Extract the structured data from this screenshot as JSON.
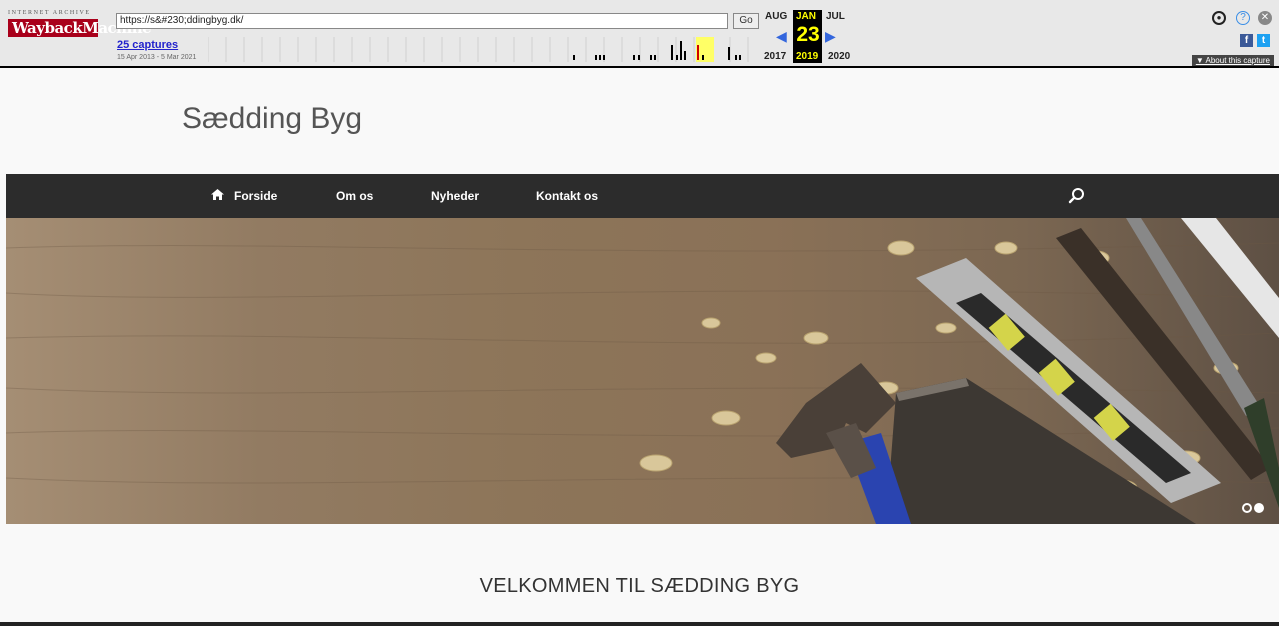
{
  "wayback": {
    "logo_top": "INTERNET ARCHIVE",
    "logo_main": "WaybackMachine",
    "url": "https://s&#230;ddingbyg.dk/",
    "go_label": "Go",
    "captures_link": "25 captures",
    "date_range": "15 Apr 2013 - 5 Mar 2021",
    "calendar": {
      "prev_month": "AUG",
      "current_month": "JAN",
      "next_month": "JUL",
      "day": "23",
      "prev_year": "2017",
      "current_year": "2019",
      "next_year": "2020"
    },
    "about_capture": "▼ About this capture",
    "colors": {
      "highlight": "#ffff00",
      "capture_mark": "#d00000",
      "link": "#2222cc"
    }
  },
  "site": {
    "title": "Sædding Byg",
    "nav": [
      {
        "label": "Forside",
        "icon": "home-icon"
      },
      {
        "label": "Om os"
      },
      {
        "label": "Nyheder"
      },
      {
        "label": "Kontakt os"
      }
    ],
    "search_icon": "search-icon",
    "welcome_heading": "VELKOMMEN TIL SÆDDING BYG",
    "slider": {
      "slides": 2,
      "active": 2
    }
  }
}
